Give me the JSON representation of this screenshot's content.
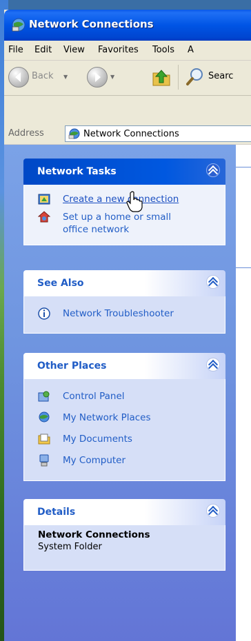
{
  "window": {
    "title": "Network Connections"
  },
  "menubar": {
    "items": [
      "File",
      "Edit",
      "View",
      "Favorites",
      "Tools",
      "A"
    ]
  },
  "toolbar": {
    "back_label": "Back",
    "search_label": "Searc"
  },
  "address": {
    "label": "Address",
    "value": "Network Connections"
  },
  "panels": {
    "network_tasks": {
      "title": "Network Tasks",
      "items": [
        {
          "label": "Create a new connection",
          "icon": "new-connection-icon"
        },
        {
          "label": "Set up a home or small office network",
          "icon": "home-network-icon"
        }
      ]
    },
    "see_also": {
      "title": "See Also",
      "items": [
        {
          "label": "Network Troubleshooter",
          "icon": "info-icon"
        }
      ]
    },
    "other_places": {
      "title": "Other Places",
      "items": [
        {
          "label": "Control Panel",
          "icon": "control-panel-icon"
        },
        {
          "label": "My Network Places",
          "icon": "network-places-icon"
        },
        {
          "label": "My Documents",
          "icon": "documents-icon"
        },
        {
          "label": "My Computer",
          "icon": "computer-icon"
        }
      ]
    },
    "details": {
      "title": "Details",
      "name": "Network Connections",
      "type": "System Folder"
    }
  },
  "colors": {
    "titlebar": "#0055e5",
    "task_pane": "#6f95e0",
    "link": "#215dc6"
  }
}
